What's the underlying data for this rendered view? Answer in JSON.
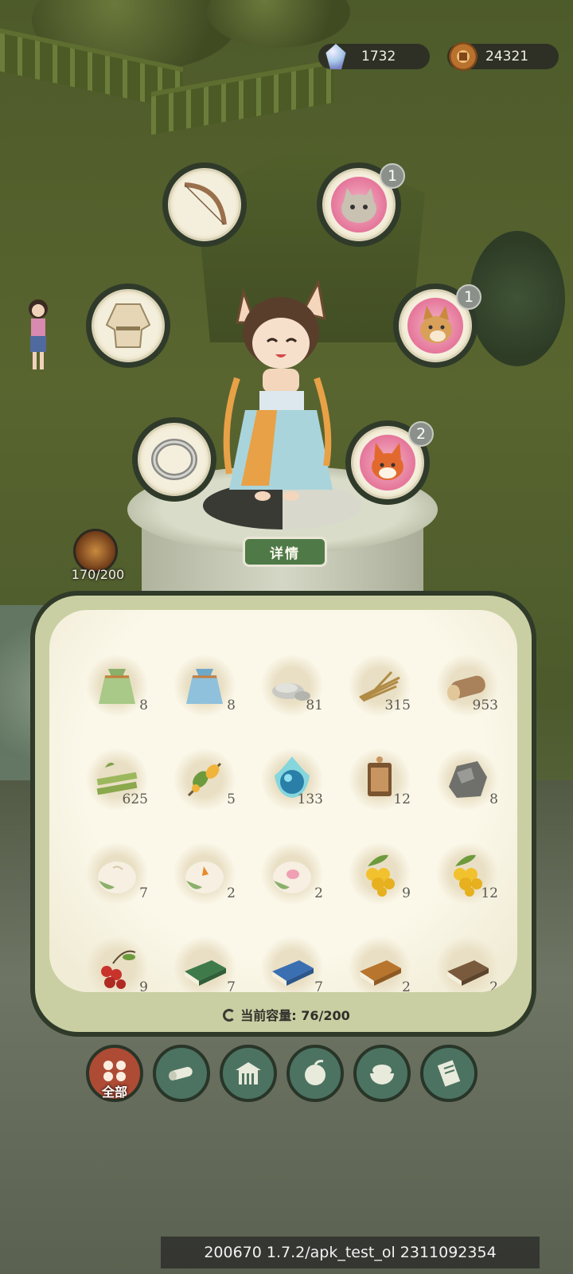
{
  "currency": {
    "gems": "1732",
    "coins": "24321"
  },
  "equipment_slots": [
    {
      "name": "bow",
      "badge": ""
    },
    {
      "name": "cat-pet",
      "badge": "1"
    },
    {
      "name": "robe",
      "badge": ""
    },
    {
      "name": "dog-pet",
      "badge": "1"
    },
    {
      "name": "ring",
      "badge": ""
    },
    {
      "name": "fox-pet",
      "badge": "2"
    }
  ],
  "detail_button": "详情",
  "level": {
    "value": "170/200"
  },
  "inventory": {
    "items": [
      {
        "icon": "green-pouch-icon",
        "count": "8"
      },
      {
        "icon": "blue-pouch-icon",
        "count": "8"
      },
      {
        "icon": "stone-icon",
        "count": "81"
      },
      {
        "icon": "straw-icon",
        "count": "315"
      },
      {
        "icon": "log-icon",
        "count": "953"
      },
      {
        "icon": "bamboo-icon",
        "count": "625"
      },
      {
        "icon": "herb-icon",
        "count": "5"
      },
      {
        "icon": "blue-flame-orb-icon",
        "count": "133"
      },
      {
        "icon": "token-icon",
        "count": "12"
      },
      {
        "icon": "ore-icon",
        "count": "8"
      },
      {
        "icon": "bun-icon",
        "count": "7"
      },
      {
        "icon": "bun-orange-icon",
        "count": "2"
      },
      {
        "icon": "bun-pink-icon",
        "count": "2"
      },
      {
        "icon": "yellow-berries-icon",
        "count": "9"
      },
      {
        "icon": "yellow-berries-icon",
        "count": "12"
      },
      {
        "icon": "red-berries-icon",
        "count": "9"
      },
      {
        "icon": "green-book-icon",
        "count": "7"
      },
      {
        "icon": "blue-book-icon",
        "count": "7"
      },
      {
        "icon": "orange-book-icon",
        "count": "2"
      },
      {
        "icon": "brown-book-icon",
        "count": "2"
      }
    ],
    "capacity_label": "当前容量:",
    "capacity_value": "76/200"
  },
  "tabs": [
    {
      "icon": "all-icon",
      "label": "全部",
      "active": true
    },
    {
      "icon": "wood-icon",
      "label": ""
    },
    {
      "icon": "building-icon",
      "label": ""
    },
    {
      "icon": "fruit-icon",
      "label": ""
    },
    {
      "icon": "food-bowl-icon",
      "label": ""
    },
    {
      "icon": "scroll-icon",
      "label": ""
    }
  ],
  "version_text": "200670  1.7.2/apk_test_ol  2311092354",
  "colors": {
    "tab_active": "#ad4b34",
    "tab": "#4c7361",
    "detail_button": "#4f7a48",
    "pet_bg": "#e5759a"
  }
}
